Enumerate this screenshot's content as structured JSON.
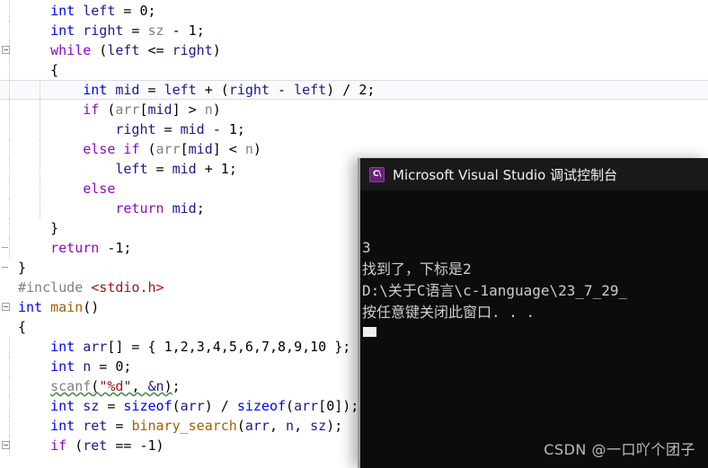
{
  "editor": {
    "name": "visual-studio-code-editor",
    "background": "#ffffff",
    "font_size_px": 15,
    "line_height_px": 22,
    "current_line_index": 4,
    "colors": {
      "keyword": "#0000ff",
      "control_keyword": "#8f08c4",
      "identifier": "#1a1a8c",
      "parameter": "#808080",
      "function": "#a06000",
      "string": "#a31515",
      "preprocessor": "#808080",
      "plain": "#000000",
      "squiggle": "#3d8b3d",
      "current_line_border": "#dcdce6"
    },
    "lines": [
      {
        "indent_guides": [
          1
        ],
        "outline": "",
        "tokens": [
          {
            "t": "    ",
            "c": "plain"
          },
          {
            "t": "int",
            "c": "kw"
          },
          {
            "t": " ",
            "c": "plain"
          },
          {
            "t": "left",
            "c": "id"
          },
          {
            "t": " = ",
            "c": "punc"
          },
          {
            "t": "0",
            "c": "num"
          },
          {
            "t": ";",
            "c": "punc"
          }
        ]
      },
      {
        "indent_guides": [
          1
        ],
        "outline": "",
        "tokens": [
          {
            "t": "    ",
            "c": "plain"
          },
          {
            "t": "int",
            "c": "kw"
          },
          {
            "t": " ",
            "c": "plain"
          },
          {
            "t": "right",
            "c": "id"
          },
          {
            "t": " = ",
            "c": "punc"
          },
          {
            "t": "sz",
            "c": "pid"
          },
          {
            "t": " - ",
            "c": "punc"
          },
          {
            "t": "1",
            "c": "num"
          },
          {
            "t": ";",
            "c": "punc"
          }
        ]
      },
      {
        "indent_guides": [
          1
        ],
        "outline": "box",
        "tokens": [
          {
            "t": "    ",
            "c": "plain"
          },
          {
            "t": "while",
            "c": "ctl"
          },
          {
            "t": " (",
            "c": "punc"
          },
          {
            "t": "left",
            "c": "id"
          },
          {
            "t": " <= ",
            "c": "punc"
          },
          {
            "t": "right",
            "c": "id"
          },
          {
            "t": ")",
            "c": "punc"
          }
        ]
      },
      {
        "indent_guides": [
          1
        ],
        "outline": "",
        "tokens": [
          {
            "t": "    {",
            "c": "punc"
          }
        ]
      },
      {
        "indent_guides": [
          1,
          2
        ],
        "outline": "",
        "current": true,
        "tokens": [
          {
            "t": "        ",
            "c": "plain"
          },
          {
            "t": "int",
            "c": "kw"
          },
          {
            "t": " ",
            "c": "plain"
          },
          {
            "t": "mid",
            "c": "id"
          },
          {
            "t": " = ",
            "c": "punc"
          },
          {
            "t": "left",
            "c": "id"
          },
          {
            "t": " + (",
            "c": "punc"
          },
          {
            "t": "right",
            "c": "id"
          },
          {
            "t": " - ",
            "c": "punc"
          },
          {
            "t": "left",
            "c": "id"
          },
          {
            "t": ") / ",
            "c": "punc"
          },
          {
            "t": "2",
            "c": "num"
          },
          {
            "t": ";",
            "c": "punc"
          }
        ]
      },
      {
        "indent_guides": [
          1,
          2
        ],
        "outline": "",
        "tokens": [
          {
            "t": "        ",
            "c": "plain"
          },
          {
            "t": "if",
            "c": "ctl"
          },
          {
            "t": " (",
            "c": "punc"
          },
          {
            "t": "arr",
            "c": "pid"
          },
          {
            "t": "[",
            "c": "punc"
          },
          {
            "t": "mid",
            "c": "id"
          },
          {
            "t": "] > ",
            "c": "punc"
          },
          {
            "t": "n",
            "c": "pid"
          },
          {
            "t": ")",
            "c": "punc"
          }
        ]
      },
      {
        "indent_guides": [
          1,
          2
        ],
        "outline": "",
        "tokens": [
          {
            "t": "            ",
            "c": "plain"
          },
          {
            "t": "right",
            "c": "id"
          },
          {
            "t": " = ",
            "c": "punc"
          },
          {
            "t": "mid",
            "c": "id"
          },
          {
            "t": " - ",
            "c": "punc"
          },
          {
            "t": "1",
            "c": "num"
          },
          {
            "t": ";",
            "c": "punc"
          }
        ]
      },
      {
        "indent_guides": [
          1,
          2
        ],
        "outline": "",
        "tokens": [
          {
            "t": "        ",
            "c": "plain"
          },
          {
            "t": "else",
            "c": "ctl"
          },
          {
            "t": " ",
            "c": "plain"
          },
          {
            "t": "if",
            "c": "ctl"
          },
          {
            "t": " (",
            "c": "punc"
          },
          {
            "t": "arr",
            "c": "pid"
          },
          {
            "t": "[",
            "c": "punc"
          },
          {
            "t": "mid",
            "c": "id"
          },
          {
            "t": "] < ",
            "c": "punc"
          },
          {
            "t": "n",
            "c": "pid"
          },
          {
            "t": ")",
            "c": "punc"
          }
        ]
      },
      {
        "indent_guides": [
          1,
          2
        ],
        "outline": "",
        "tokens": [
          {
            "t": "            ",
            "c": "plain"
          },
          {
            "t": "left",
            "c": "id"
          },
          {
            "t": " = ",
            "c": "punc"
          },
          {
            "t": "mid",
            "c": "id"
          },
          {
            "t": " + ",
            "c": "punc"
          },
          {
            "t": "1",
            "c": "num"
          },
          {
            "t": ";",
            "c": "punc"
          }
        ]
      },
      {
        "indent_guides": [
          1,
          2
        ],
        "outline": "",
        "tokens": [
          {
            "t": "        ",
            "c": "plain"
          },
          {
            "t": "else",
            "c": "ctl"
          }
        ]
      },
      {
        "indent_guides": [
          1,
          2
        ],
        "outline": "",
        "tokens": [
          {
            "t": "            ",
            "c": "plain"
          },
          {
            "t": "return",
            "c": "ctl"
          },
          {
            "t": " ",
            "c": "plain"
          },
          {
            "t": "mid",
            "c": "id"
          },
          {
            "t": ";",
            "c": "punc"
          }
        ]
      },
      {
        "indent_guides": [
          1
        ],
        "outline": "",
        "tokens": [
          {
            "t": "    }",
            "c": "punc"
          }
        ]
      },
      {
        "indent_guides": [
          1
        ],
        "outline": "dash",
        "tokens": [
          {
            "t": "    ",
            "c": "plain"
          },
          {
            "t": "return",
            "c": "ctl"
          },
          {
            "t": " -",
            "c": "punc"
          },
          {
            "t": "1",
            "c": "num"
          },
          {
            "t": ";",
            "c": "punc"
          }
        ]
      },
      {
        "indent_guides": [],
        "outline": "dash",
        "tokens": [
          {
            "t": "}",
            "c": "punc"
          }
        ]
      },
      {
        "indent_guides": [],
        "outline": "",
        "tokens": [
          {
            "t": "#include",
            "c": "pp"
          },
          {
            "t": " ",
            "c": "plain"
          },
          {
            "t": "<stdio.h>",
            "c": "str"
          }
        ]
      },
      {
        "indent_guides": [],
        "outline": "box",
        "tokens": [
          {
            "t": "int",
            "c": "kw"
          },
          {
            "t": " ",
            "c": "plain"
          },
          {
            "t": "main",
            "c": "fn"
          },
          {
            "t": "()",
            "c": "punc"
          }
        ]
      },
      {
        "indent_guides": [],
        "outline": "",
        "tokens": [
          {
            "t": "{",
            "c": "punc"
          }
        ]
      },
      {
        "indent_guides": [
          1
        ],
        "outline": "",
        "tokens": [
          {
            "t": "    ",
            "c": "plain"
          },
          {
            "t": "int",
            "c": "kw"
          },
          {
            "t": " ",
            "c": "plain"
          },
          {
            "t": "arr",
            "c": "id"
          },
          {
            "t": "[] = { ",
            "c": "punc"
          },
          {
            "t": "1",
            "c": "num"
          },
          {
            "t": ",",
            "c": "punc"
          },
          {
            "t": "2",
            "c": "num"
          },
          {
            "t": ",",
            "c": "punc"
          },
          {
            "t": "3",
            "c": "num"
          },
          {
            "t": ",",
            "c": "punc"
          },
          {
            "t": "4",
            "c": "num"
          },
          {
            "t": ",",
            "c": "punc"
          },
          {
            "t": "5",
            "c": "num"
          },
          {
            "t": ",",
            "c": "punc"
          },
          {
            "t": "6",
            "c": "num"
          },
          {
            "t": ",",
            "c": "punc"
          },
          {
            "t": "7",
            "c": "num"
          },
          {
            "t": ",",
            "c": "punc"
          },
          {
            "t": "8",
            "c": "num"
          },
          {
            "t": ",",
            "c": "punc"
          },
          {
            "t": "9",
            "c": "num"
          },
          {
            "t": ",",
            "c": "punc"
          },
          {
            "t": "10",
            "c": "num"
          },
          {
            "t": " };",
            "c": "punc"
          }
        ]
      },
      {
        "indent_guides": [
          1
        ],
        "outline": "",
        "tokens": [
          {
            "t": "    ",
            "c": "plain"
          },
          {
            "t": "int",
            "c": "kw"
          },
          {
            "t": " ",
            "c": "plain"
          },
          {
            "t": "n",
            "c": "id"
          },
          {
            "t": " = ",
            "c": "punc"
          },
          {
            "t": "0",
            "c": "num"
          },
          {
            "t": ";",
            "c": "punc"
          }
        ]
      },
      {
        "indent_guides": [
          1
        ],
        "outline": "",
        "tokens": [
          {
            "t": "    ",
            "c": "plain"
          },
          {
            "t": "scanf",
            "c": "pid squig"
          },
          {
            "t": "(",
            "c": "punc squig"
          },
          {
            "t": "\"%d\"",
            "c": "str squig"
          },
          {
            "t": ", ",
            "c": "punc squig"
          },
          {
            "t": "&n",
            "c": "id squig"
          },
          {
            "t": ")",
            "c": "punc squig"
          },
          {
            "t": ";",
            "c": "punc"
          }
        ]
      },
      {
        "indent_guides": [
          1
        ],
        "outline": "",
        "tokens": [
          {
            "t": "    ",
            "c": "plain"
          },
          {
            "t": "int",
            "c": "kw"
          },
          {
            "t": " ",
            "c": "plain"
          },
          {
            "t": "sz",
            "c": "id"
          },
          {
            "t": " = ",
            "c": "punc"
          },
          {
            "t": "sizeof",
            "c": "kw"
          },
          {
            "t": "(",
            "c": "punc"
          },
          {
            "t": "arr",
            "c": "id"
          },
          {
            "t": ") / ",
            "c": "punc"
          },
          {
            "t": "sizeof",
            "c": "kw"
          },
          {
            "t": "(",
            "c": "punc"
          },
          {
            "t": "arr",
            "c": "id"
          },
          {
            "t": "[",
            "c": "punc"
          },
          {
            "t": "0",
            "c": "num"
          },
          {
            "t": "]);",
            "c": "punc"
          }
        ]
      },
      {
        "indent_guides": [
          1
        ],
        "outline": "",
        "tokens": [
          {
            "t": "    ",
            "c": "plain"
          },
          {
            "t": "int",
            "c": "kw"
          },
          {
            "t": " ",
            "c": "plain"
          },
          {
            "t": "ret",
            "c": "id"
          },
          {
            "t": " = ",
            "c": "punc"
          },
          {
            "t": "binary_search",
            "c": "fn"
          },
          {
            "t": "(",
            "c": "punc"
          },
          {
            "t": "arr",
            "c": "id"
          },
          {
            "t": ", ",
            "c": "punc"
          },
          {
            "t": "n",
            "c": "id"
          },
          {
            "t": ", ",
            "c": "punc"
          },
          {
            "t": "sz",
            "c": "id"
          },
          {
            "t": ");",
            "c": "punc"
          }
        ]
      },
      {
        "indent_guides": [
          1
        ],
        "outline": "box",
        "tokens": [
          {
            "t": "    ",
            "c": "plain"
          },
          {
            "t": "if",
            "c": "ctl"
          },
          {
            "t": " (",
            "c": "punc"
          },
          {
            "t": "ret",
            "c": "id"
          },
          {
            "t": " == -",
            "c": "punc"
          },
          {
            "t": "1",
            "c": "num"
          },
          {
            "t": ")",
            "c": "punc"
          }
        ]
      }
    ]
  },
  "console": {
    "name": "vs-debug-console",
    "icon": "console-app-icon",
    "icon_glyph": "C\\",
    "icon_color": "#68217a",
    "title": "Microsoft Visual Studio 调试控制台",
    "titlebar_color": "#191919",
    "background": "#0c0c0c",
    "text_color": "#cccccc",
    "output_lines": [
      "3",
      "找到了，下标是2",
      "D:\\关于C语言\\c-1anguage\\23_7_29_",
      "按任意键关闭此窗口. . ."
    ],
    "cursor": "block-cursor"
  },
  "watermark": {
    "name": "csdn-watermark",
    "text": "CSDN @一口吖个团子",
    "color": "#bdbdbd"
  }
}
